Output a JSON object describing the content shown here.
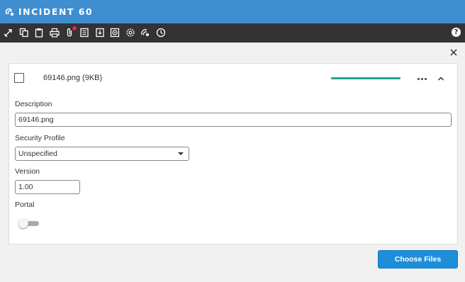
{
  "window": {
    "title": "INCIDENT 60"
  },
  "toolbar": {
    "icons": [
      "bullet-icon",
      "copy-icon",
      "clipboard-icon",
      "print-icon",
      "attachment-icon",
      "document-icon",
      "document-download-icon",
      "target-icon",
      "settings-icon",
      "signal-icon",
      "clock-icon"
    ],
    "help_label": "?",
    "attachment_badge_color": "#e0245e"
  },
  "attachment": {
    "file_label": "69146.png (9KB)",
    "upload_progress": 1.0,
    "progress_color": "#23a493"
  },
  "form": {
    "description_label": "Description",
    "description_value": "69146.png",
    "security_profile_label": "Security Profile",
    "security_profile_value": "Unspecified",
    "version_label": "Version",
    "version_value": "1.00",
    "portal_label": "Portal",
    "portal_enabled": false
  },
  "actions": {
    "choose_files_label": "Choose Files"
  },
  "colors": {
    "header": "#3e8ed0",
    "toolbar": "#333333",
    "primary_button": "#1f8ed9"
  }
}
